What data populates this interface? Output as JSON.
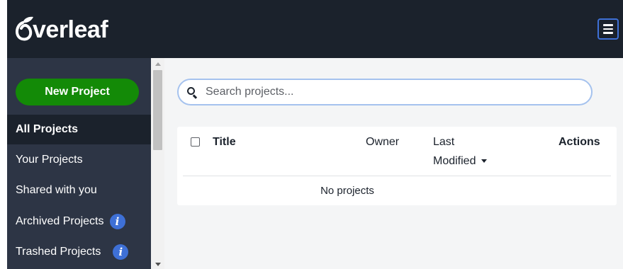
{
  "app": {
    "logo_text": "verleaf",
    "brand_color": "#138a07",
    "header_bg": "#1b222c",
    "accent": "#3e70d6"
  },
  "header": {
    "menu_icon": "hamburger-menu-icon"
  },
  "sidebar": {
    "new_project_label": "New Project",
    "items": [
      {
        "label": "All Projects",
        "active": true
      },
      {
        "label": "Your Projects"
      },
      {
        "label": "Shared with you"
      },
      {
        "label": "Archived Projects",
        "icon": "info-icon"
      },
      {
        "label": "Trashed Projects",
        "icon": "info-icon"
      }
    ]
  },
  "search": {
    "placeholder": "Search projects..."
  },
  "table": {
    "columns": {
      "title": "Title",
      "owner": "Owner",
      "last_modified_1": "Last",
      "last_modified_2": "Modified",
      "actions": "Actions"
    },
    "empty_message": "No projects"
  }
}
